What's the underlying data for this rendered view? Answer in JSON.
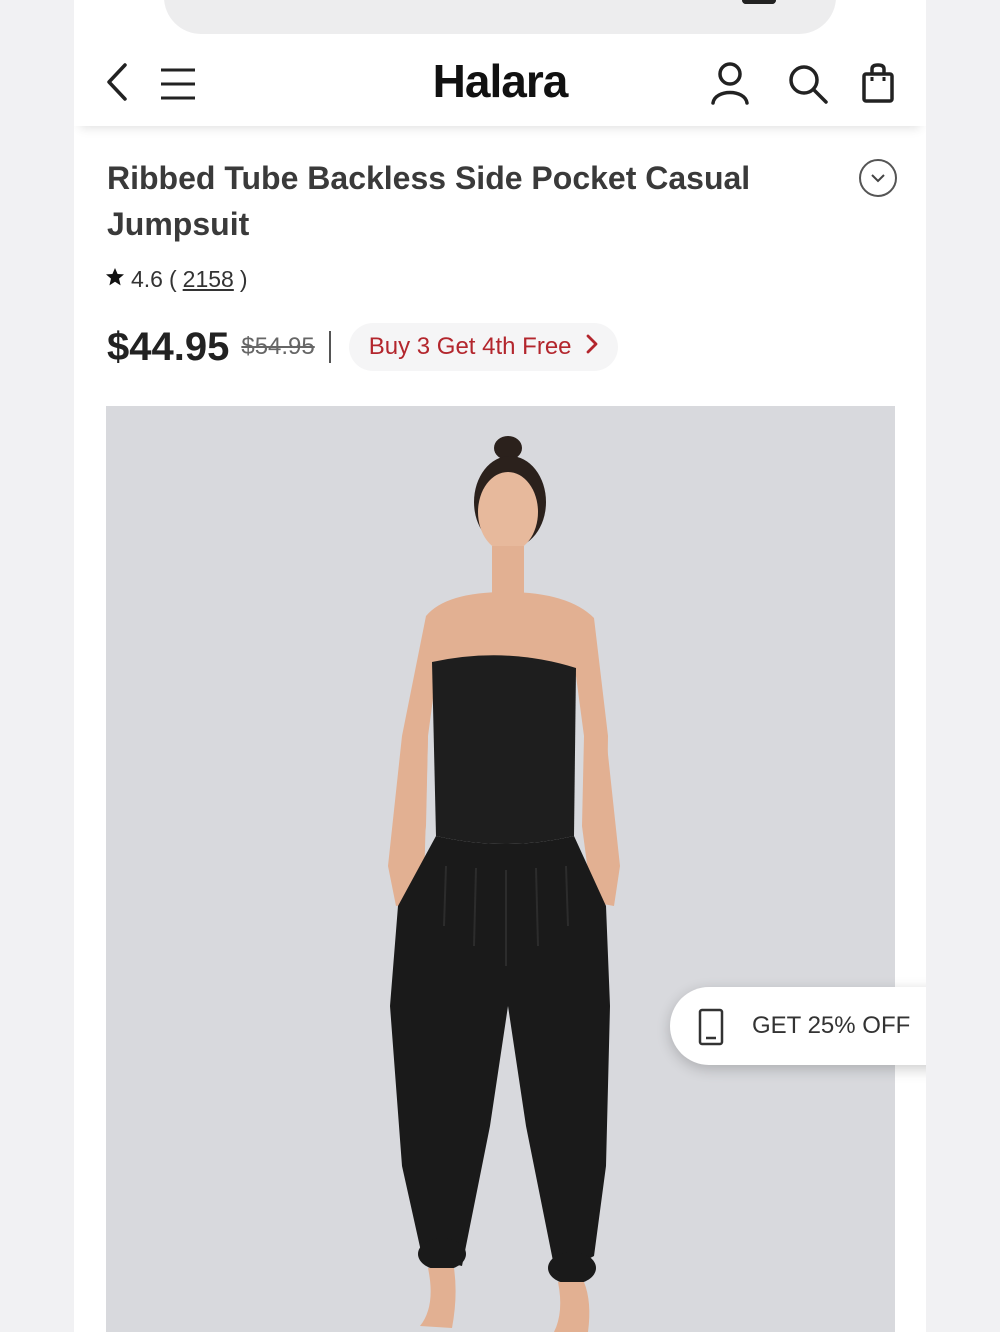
{
  "header": {
    "logo": "Halara",
    "icons": [
      "back-icon",
      "menu-icon",
      "account-icon",
      "search-icon",
      "shopping-bag-icon"
    ]
  },
  "product": {
    "title": "Ribbed Tube Backless Side Pocket Casual Jumpsuit",
    "rating": "4.6",
    "review_count": "2158",
    "price": "$44.95",
    "original_price": "$54.95",
    "promo_label": "Buy 3 Get 4th Free",
    "image_alt": "Model wearing black strapless jumpsuit"
  },
  "toast": {
    "label": "GET 25% OFF"
  },
  "colors": {
    "promo_text": "#b3262d",
    "image_background": "#d8d9dd",
    "garment": "#1a1a1a"
  }
}
